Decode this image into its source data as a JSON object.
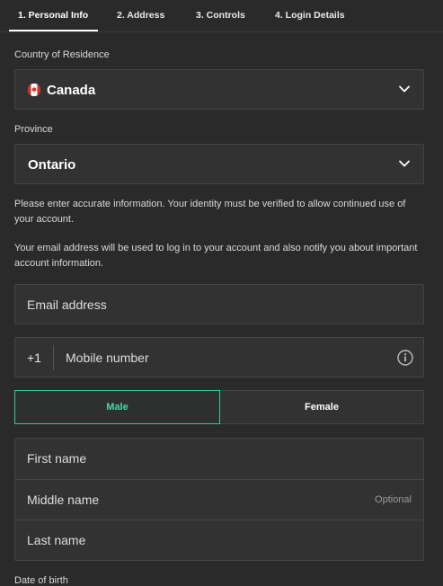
{
  "tabs": [
    {
      "label": "1.  Personal Info"
    },
    {
      "label": "2.  Address"
    },
    {
      "label": "3.  Controls"
    },
    {
      "label": "4.  Login Details"
    }
  ],
  "country": {
    "label": "Country of Residence",
    "value": "Canada",
    "flag_icon": "canada-flag-icon"
  },
  "province": {
    "label": "Province",
    "value": "Ontario"
  },
  "notices": {
    "identity": "Please enter accurate information. Your identity must be verified to allow continued use of your account.",
    "email": "Your email address will be used to log in to your account and also notify you about important account information."
  },
  "email": {
    "placeholder": "Email address"
  },
  "mobile": {
    "prefix": "+1",
    "placeholder": "Mobile number",
    "icon": "info-icon"
  },
  "gender": {
    "male": "Male",
    "female": "Female",
    "selected": "Male"
  },
  "names": {
    "first": "First name",
    "middle": "Middle name",
    "middle_hint": "Optional",
    "last": "Last name"
  },
  "dob": {
    "label": "Date of birth"
  },
  "colors": {
    "background": "#2a2a2a",
    "field": "#323232",
    "accent": "#34c896"
  }
}
